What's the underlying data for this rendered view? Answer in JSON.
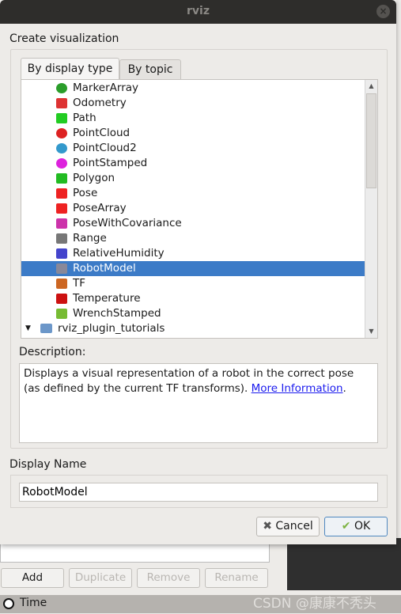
{
  "window": {
    "title": "rviz",
    "close": "×"
  },
  "dialog": {
    "heading": "Create visualization",
    "tabs": [
      {
        "label": "By display type",
        "active": true
      },
      {
        "label": "By topic",
        "active": false
      }
    ],
    "items": [
      {
        "label": "MarkerArray",
        "icon": "marker-array-icon"
      },
      {
        "label": "Odometry",
        "icon": "odometry-icon"
      },
      {
        "label": "Path",
        "icon": "path-icon"
      },
      {
        "label": "PointCloud",
        "icon": "point-cloud-icon"
      },
      {
        "label": "PointCloud2",
        "icon": "point-cloud2-icon"
      },
      {
        "label": "PointStamped",
        "icon": "point-stamped-icon"
      },
      {
        "label": "Polygon",
        "icon": "polygon-icon"
      },
      {
        "label": "Pose",
        "icon": "pose-icon"
      },
      {
        "label": "PoseArray",
        "icon": "pose-array-icon"
      },
      {
        "label": "PoseWithCovariance",
        "icon": "pose-covariance-icon"
      },
      {
        "label": "Range",
        "icon": "range-icon"
      },
      {
        "label": "RelativeHumidity",
        "icon": "humidity-icon"
      },
      {
        "label": "RobotModel",
        "icon": "robot-model-icon",
        "selected": true
      },
      {
        "label": "TF",
        "icon": "tf-icon"
      },
      {
        "label": "Temperature",
        "icon": "temperature-icon"
      },
      {
        "label": "WrenchStamped",
        "icon": "wrench-icon"
      }
    ],
    "folder": {
      "label": "rviz_plugin_tutorials",
      "expanded": true
    },
    "description_label": "Description:",
    "description_text": "Displays a visual representation of a robot in the correct pose (as defined by the current TF transforms). ",
    "description_link": "More Information",
    "description_end": ".",
    "display_name_label": "Display Name",
    "display_name_value": "RobotModel",
    "cancel_label": "Cancel",
    "ok_label": "OK"
  },
  "background": {
    "buttons": [
      {
        "label": "Add",
        "enabled": true
      },
      {
        "label": "Duplicate",
        "enabled": false
      },
      {
        "label": "Remove",
        "enabled": false
      },
      {
        "label": "Rename",
        "enabled": false
      }
    ],
    "time_label": "Time"
  },
  "watermark": "CSDN @康康不秃头",
  "colors": {
    "selection": "#3c7bc7",
    "titlebar": "#2e2d2b",
    "link": "#1a1aee"
  }
}
